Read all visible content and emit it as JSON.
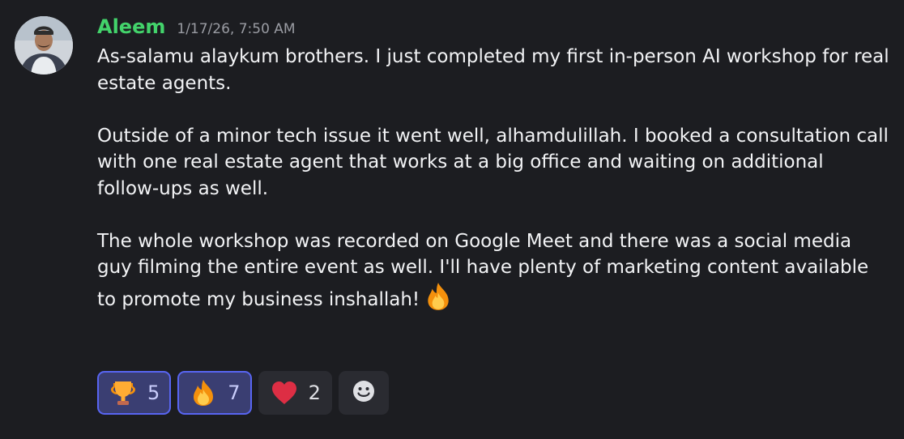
{
  "message": {
    "author": "Aleem",
    "timestamp": "1/17/26, 7:50 AM",
    "paragraphs": [
      "As-salamu alaykum brothers. I just completed my first in-person AI workshop for real estate agents.",
      "Outside of a minor tech issue it went well, alhamdulillah. I booked a consultation call with one real estate agent that works at a big office and waiting on additional follow-ups as well.",
      "The whole workshop was recorded on Google Meet and there was a social media guy filming the entire event as well. I'll have plenty of marketing content available to promote my business inshallah!"
    ],
    "trailing_emoji": "fire-icon"
  },
  "reactions": [
    {
      "emoji": "trophy-icon",
      "count": "5",
      "selected": true
    },
    {
      "emoji": "fire-icon",
      "count": "7",
      "selected": true
    },
    {
      "emoji": "heart-icon",
      "count": "2",
      "selected": false
    }
  ],
  "add_reaction": {
    "icon": "add-reaction-smiley-icon"
  },
  "colors": {
    "background": "#1c1d21",
    "username": "#43d36b",
    "timestamp": "#9a9ca3",
    "selected_reaction_bg": "#3a3e72",
    "selected_reaction_border": "#5865f2",
    "reaction_bg": "#2a2b31"
  }
}
